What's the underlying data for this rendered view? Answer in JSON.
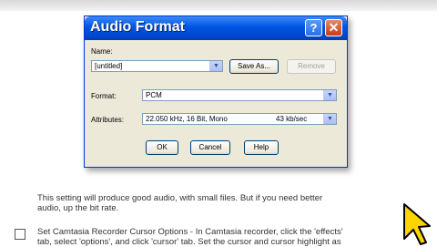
{
  "dialog": {
    "title": "Audio Format",
    "help_label": "?",
    "close_label": "✕",
    "name_label": "Name:",
    "name_value": "[untitled]",
    "save_as_label": "Save As...",
    "remove_label": "Remove",
    "format_label": "Format:",
    "format_value": "PCM",
    "attributes_label": "Attributes:",
    "attributes_value": "22.050 kHz, 16 Bit, Mono",
    "attributes_rate": "43 kb/sec",
    "ok_label": "OK",
    "cancel_label": "Cancel",
    "help_button_label": "Help"
  },
  "content": {
    "paragraph_line1": "This setting will produce good audio, with small files. But if you need better",
    "paragraph_line2": "audio, up the bit rate.",
    "step_line1": "Set Camtasia Recorder Cursor Options - In Camtasia recorder, click the 'effects'",
    "step_line2": "tab, select 'options', and click 'cursor' tab. Set the cursor and cursor highlight as"
  },
  "colors": {
    "titlebar": "#0054e3",
    "dialog_bg": "#ece9d8",
    "cursor_fill": "#ffd400"
  },
  "icons": {
    "dropdown": "chevron-down-icon",
    "cursor": "mouse-cursor-icon"
  }
}
